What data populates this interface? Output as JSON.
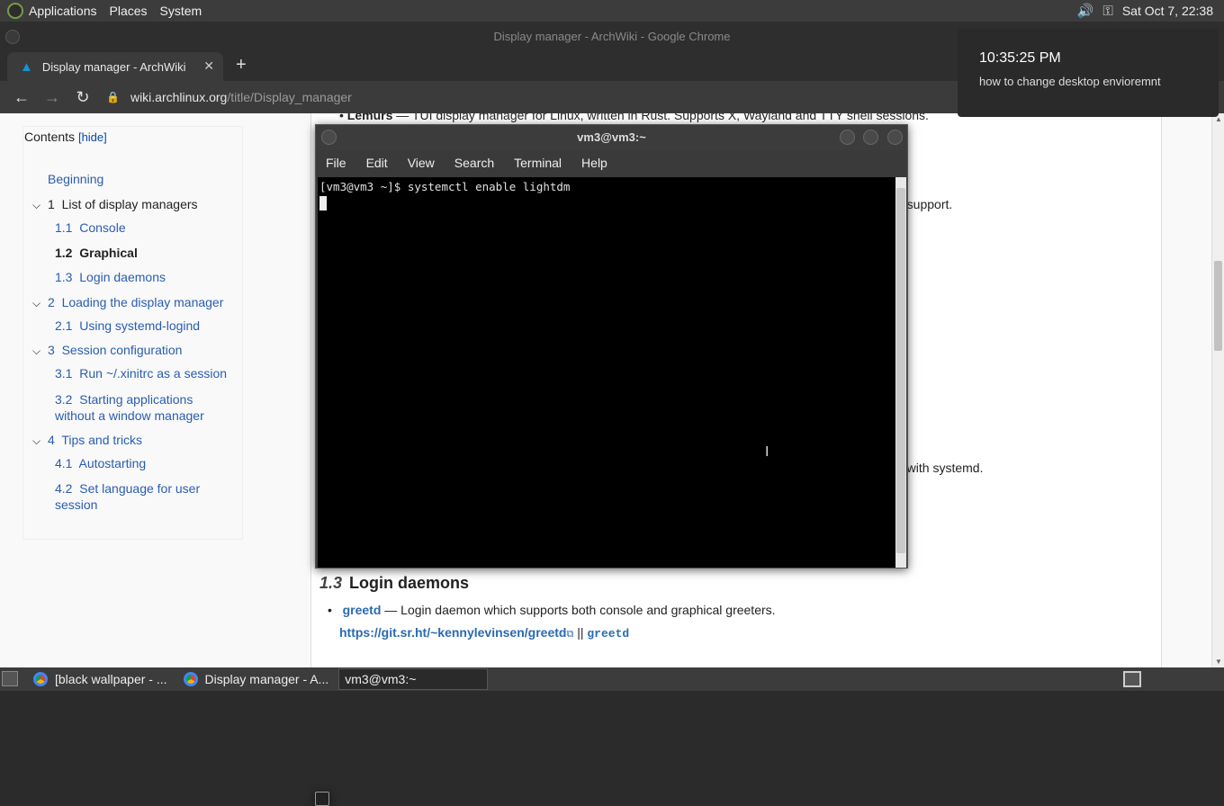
{
  "top_panel": {
    "menus": [
      "Applications",
      "Places",
      "System"
    ],
    "clock": "Sat Oct  7, 22:38",
    "icons": [
      "distro-logo-icon",
      "volume-icon",
      "network-key-icon"
    ]
  },
  "chrome": {
    "window_title": "Display manager - ArchWiki - Google Chrome",
    "tab_title": "Display manager - ArchWiki",
    "url_host": "wiki.archlinux.org",
    "url_path": "/title/Display_manager"
  },
  "notification": {
    "time": "10:35:25 PM",
    "message": "how to change desktop envioremnt"
  },
  "toc": {
    "title": "Contents",
    "hide_label": "hide",
    "items": [
      {
        "num": "",
        "label": "Beginning",
        "level": 0
      },
      {
        "num": "1",
        "label": "List of display managers",
        "level": 0
      },
      {
        "num": "1.1",
        "label": "Console",
        "level": 1
      },
      {
        "num": "1.2",
        "label": "Graphical",
        "level": 1
      },
      {
        "num": "1.3",
        "label": "Login daemons",
        "level": 1
      },
      {
        "num": "2",
        "label": "Loading the display manager",
        "level": 0
      },
      {
        "num": "2.1",
        "label": "Using systemd-logind",
        "level": 1
      },
      {
        "num": "3",
        "label": "Session configuration",
        "level": 0
      },
      {
        "num": "3.1",
        "label": "Run ~/.xinitrc as a session",
        "level": 1
      },
      {
        "num": "3.2",
        "label": "Starting applications without a window manager",
        "level": 1
      },
      {
        "num": "4",
        "label": "Tips and tricks",
        "level": 0
      },
      {
        "num": "4.1",
        "label": "Autostarting",
        "level": 1
      },
      {
        "num": "4.2",
        "label": "Set language for user session",
        "level": 1
      }
    ]
  },
  "article": {
    "top_fragment_bold": "Lemurs",
    "top_fragment_rest": " — TUI display manager for Linux, written in Rust. Supports X, Wayland and TTY shell sessions.",
    "fragment_support": "d support.",
    "fragment_systemd": "e with systemd.",
    "section_num": "1.3",
    "section_title": "Login daemons",
    "greetd_name": "greetd",
    "greetd_desc": " — Login daemon which supports both console and graphical greeters.",
    "greetd_url": "https://git.sr.ht/~kennylevinsen/greetd",
    "separator": " || ",
    "greetd_pkg": "greetd"
  },
  "terminal": {
    "title": "vm3@vm3:~",
    "menu": [
      "File",
      "Edit",
      "View",
      "Search",
      "Terminal",
      "Help"
    ],
    "line1": "[vm3@vm3 ~]$ systemctl enable lightdm"
  },
  "taskbar": {
    "tasks": [
      "[black wallpaper - ...",
      "Display manager - A...",
      "vm3@vm3:~"
    ]
  }
}
